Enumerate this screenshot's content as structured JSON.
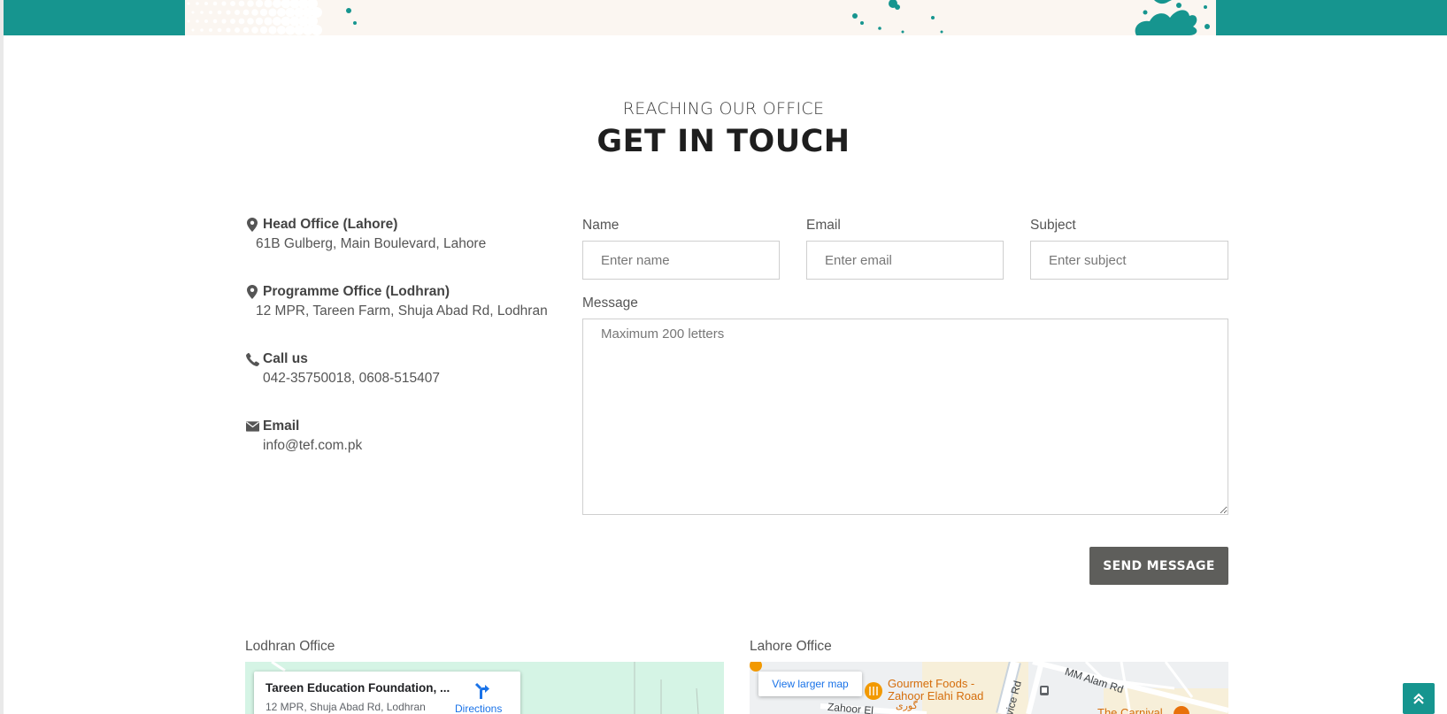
{
  "header": {
    "kicker": "REACHING OUR OFFICE",
    "title": "GET IN TOUCH"
  },
  "colors": {
    "teal": "#16958f",
    "button": "#5e5e5b",
    "cream": "#fbf6f1"
  },
  "contact": {
    "head_office": {
      "title": "Head Office (Lahore)",
      "text": "61B Gulberg, Main Boulevard, Lahore",
      "icon": "map-marker-icon"
    },
    "programme_office": {
      "title": "Programme Office (Lodhran)",
      "text": "12 MPR, Tareen Farm, Shuja Abad Rd, Lodhran",
      "icon": "map-marker-icon"
    },
    "call": {
      "title": "Call us",
      "text": "042-35750018, 0608-515407",
      "icon": "phone-icon"
    },
    "email": {
      "title": "Email",
      "text": "info@tef.com.pk",
      "icon": "envelope-icon"
    }
  },
  "form": {
    "name": {
      "label": "Name",
      "placeholder": "Enter name"
    },
    "email": {
      "label": "Email",
      "placeholder": "Enter email"
    },
    "subject": {
      "label": "Subject",
      "placeholder": "Enter subject"
    },
    "message": {
      "label": "Message",
      "placeholder": "Maximum 200 letters"
    },
    "submit_label": "SEND MESSAGE"
  },
  "maps": {
    "lodhran": {
      "label": "Lodhran Office",
      "place_name": "Tareen Education Foundation, ...",
      "place_address": "12 MPR, Shuja Abad Rd, Lodhran",
      "directions_label": "Directions"
    },
    "lahore": {
      "label": "Lahore Office",
      "view_larger": "View larger map",
      "poi_name_line1": "Gourmet Foods -",
      "poi_name_line2": "Zahoor Elahi Road",
      "street_1": "MM Alam Rd",
      "street_2": "Zahoor El",
      "street_3": "vice Rd",
      "poi_2": "The Carnival",
      "urdu_label": "گوری"
    }
  }
}
